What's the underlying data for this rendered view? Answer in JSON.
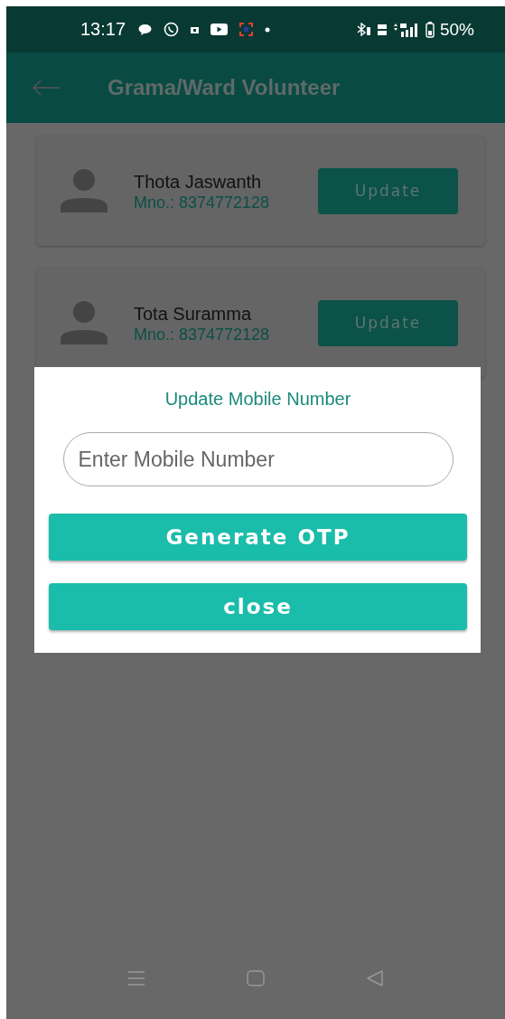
{
  "status_bar": {
    "time": "13:17",
    "battery": "50%"
  },
  "app_bar": {
    "title": "Grama/Ward Volunteer"
  },
  "volunteers": [
    {
      "name": "Thota Jaswanth",
      "mobile": "Mno.: 8374772128",
      "button": "Update"
    },
    {
      "name": "Tota Suramma",
      "mobile": "Mno.: 8374772128",
      "button": "Update"
    }
  ],
  "dialog": {
    "title": "Update Mobile Number",
    "placeholder": "Enter Mobile Number",
    "buttons": [
      "Generate OTP",
      "close"
    ]
  }
}
